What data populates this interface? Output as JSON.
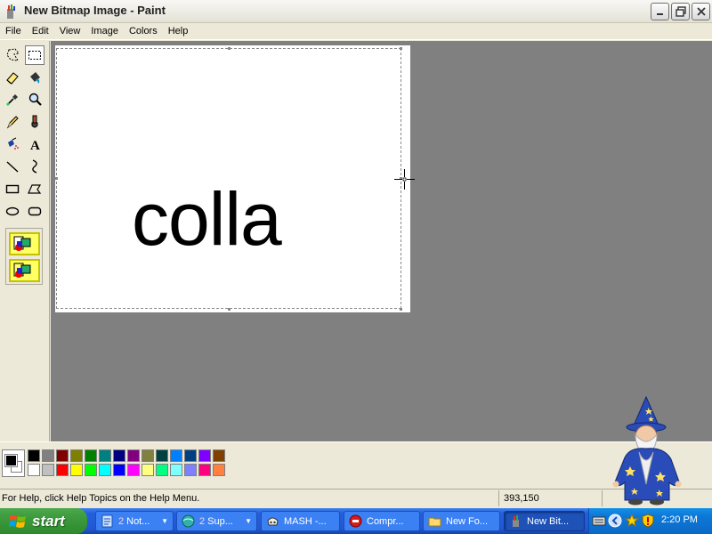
{
  "window": {
    "title": "New Bitmap Image - Paint",
    "buttons": {
      "minimize": "minimize",
      "maximize": "restore",
      "close": "close"
    }
  },
  "menu": [
    "File",
    "Edit",
    "View",
    "Image",
    "Colors",
    "Help"
  ],
  "tools": [
    {
      "name": "free-form-select-icon",
      "active": false
    },
    {
      "name": "rect-select-icon",
      "active": true
    },
    {
      "name": "eraser-icon",
      "active": false
    },
    {
      "name": "fill-bucket-icon",
      "active": false
    },
    {
      "name": "color-picker-icon",
      "active": false
    },
    {
      "name": "magnifier-icon",
      "active": false
    },
    {
      "name": "pencil-icon",
      "active": false
    },
    {
      "name": "brush-icon",
      "active": false
    },
    {
      "name": "airbrush-icon",
      "active": false
    },
    {
      "name": "text-icon",
      "active": false,
      "glyph": "A"
    },
    {
      "name": "line-icon",
      "active": false
    },
    {
      "name": "curve-icon",
      "active": false
    },
    {
      "name": "rectangle-icon",
      "active": false
    },
    {
      "name": "polygon-icon",
      "active": false
    },
    {
      "name": "ellipse-icon",
      "active": false
    },
    {
      "name": "rounded-rect-icon",
      "active": false
    }
  ],
  "canvas": {
    "text": "colla"
  },
  "palette": {
    "foreground": "#000000",
    "background": "#ffffff",
    "row1": [
      "#000000",
      "#808080",
      "#800000",
      "#808000",
      "#008000",
      "#008080",
      "#000080",
      "#800080",
      "#808040",
      "#004040",
      "#0080ff",
      "#004080",
      "#8000ff",
      "#804000"
    ],
    "row2": [
      "#ffffff",
      "#c0c0c0",
      "#ff0000",
      "#ffff00",
      "#00ff00",
      "#00ffff",
      "#0000ff",
      "#ff00ff",
      "#ffff80",
      "#00ff80",
      "#80ffff",
      "#8080ff",
      "#ff0080",
      "#ff8040"
    ]
  },
  "status": {
    "help": "For Help, click Help Topics on the Help Menu.",
    "coords": "393,150"
  },
  "taskbar": {
    "start_label": "start",
    "tasks": [
      {
        "count": "2",
        "label": "Not...",
        "group": true,
        "active": false,
        "icon": "notepad-icon"
      },
      {
        "count": "2",
        "label": "Sup...",
        "group": true,
        "active": false,
        "icon": "browser-icon"
      },
      {
        "count": "",
        "label": "MASH -...",
        "group": false,
        "active": false,
        "icon": "mash-icon"
      },
      {
        "count": "",
        "label": "Compr...",
        "group": false,
        "active": false,
        "icon": "compress-icon"
      },
      {
        "count": "",
        "label": "New Fo...",
        "group": false,
        "active": false,
        "icon": "folder-icon"
      },
      {
        "count": "",
        "label": "New Bit...",
        "group": false,
        "active": true,
        "icon": "paint-icon"
      }
    ],
    "clock": "2:20 PM"
  }
}
